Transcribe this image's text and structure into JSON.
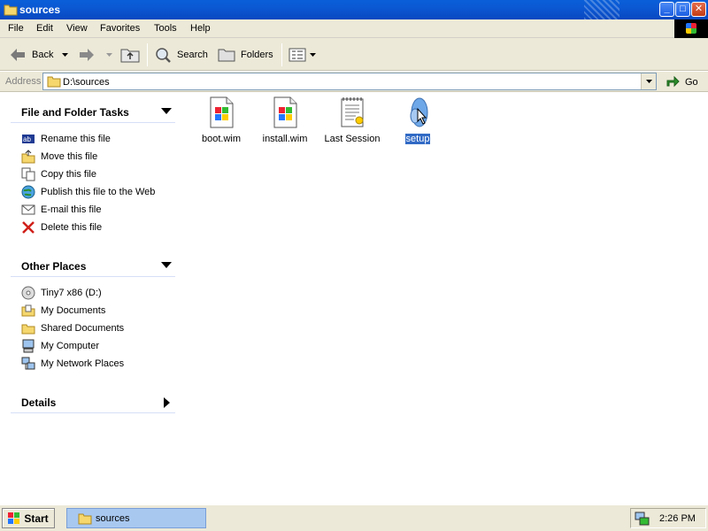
{
  "window": {
    "title": "sources"
  },
  "menu": [
    "File",
    "Edit",
    "View",
    "Favorites",
    "Tools",
    "Help"
  ],
  "toolbar": {
    "back": "Back",
    "search": "Search",
    "folders": "Folders"
  },
  "address": {
    "label": "Address",
    "value": "D:\\sources",
    "go": "Go"
  },
  "tasks": {
    "title": "File and Folder Tasks",
    "items": [
      {
        "label": "Rename this file",
        "icon": "rename-icon"
      },
      {
        "label": "Move this file",
        "icon": "move-icon"
      },
      {
        "label": "Copy this file",
        "icon": "copy-icon"
      },
      {
        "label": "Publish this file to the Web",
        "icon": "globe-icon"
      },
      {
        "label": "E-mail this file",
        "icon": "envelope-icon"
      },
      {
        "label": "Delete this file",
        "icon": "delete-x-icon"
      }
    ]
  },
  "places": {
    "title": "Other Places",
    "items": [
      {
        "label": "Tiny7 x86 (D:)",
        "icon": "cd-drive-icon"
      },
      {
        "label": "My Documents",
        "icon": "documents-folder-icon"
      },
      {
        "label": "Shared Documents",
        "icon": "folder-icon"
      },
      {
        "label": "My Computer",
        "icon": "computer-icon"
      },
      {
        "label": "My Network Places",
        "icon": "network-icon"
      }
    ]
  },
  "details": {
    "title": "Details"
  },
  "files": [
    {
      "label": "boot.wim",
      "icon": "wim-file-icon",
      "selected": false
    },
    {
      "label": "install.wim",
      "icon": "wim-file-icon",
      "selected": false
    },
    {
      "label": "Last Session",
      "icon": "notepad-file-icon",
      "selected": false
    },
    {
      "label": "setup",
      "icon": "setup-icon",
      "selected": true
    }
  ],
  "taskbar": {
    "start": "Start",
    "task": "sources",
    "clock": "2:26 PM"
  },
  "colors": {
    "titlebar": "#0a5fd8",
    "selection": "#316ac5",
    "taskbutton": "#a8c8f0"
  }
}
